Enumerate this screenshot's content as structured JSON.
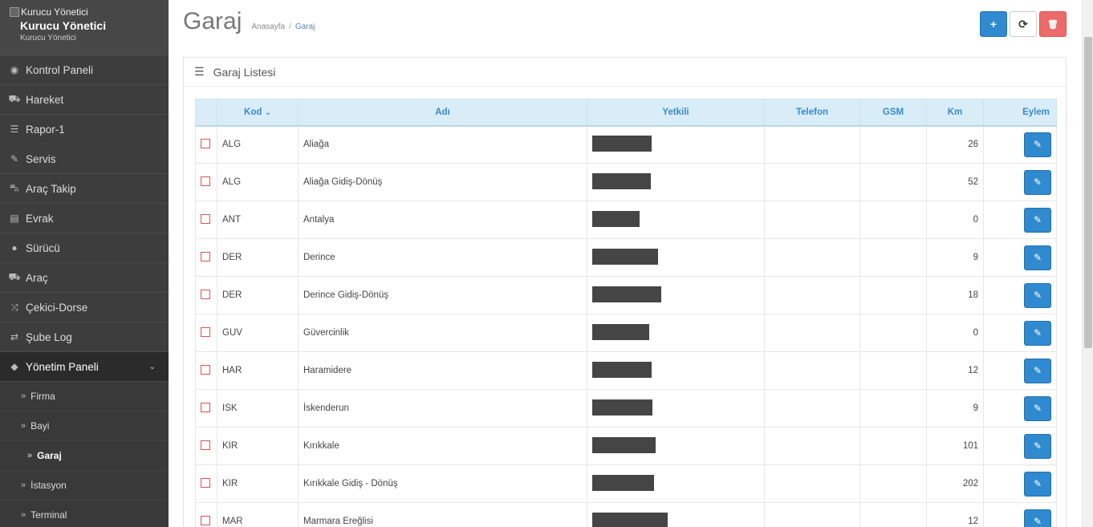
{
  "brand": {
    "logo_alt": "Kurucu Yönetici",
    "name": "Kurucu Yönetici",
    "role": "Kurucu Yönetici"
  },
  "nav": [
    {
      "label": "Kontrol Paneli",
      "icon": "dashboard-icon",
      "glyph": "◉"
    },
    {
      "label": "Hareket",
      "icon": "truck-icon",
      "glyph": "⛟"
    },
    {
      "label": "Rapor-1",
      "icon": "list-icon",
      "glyph": "☰"
    },
    {
      "label": "Servis",
      "icon": "wrench-icon",
      "glyph": "✎"
    },
    {
      "label": "Araç Takip",
      "icon": "car-icon",
      "glyph": "⛍"
    },
    {
      "label": "Evrak",
      "icon": "newspaper-icon",
      "glyph": "▤"
    },
    {
      "label": "Sürücü",
      "icon": "user-icon",
      "glyph": "●"
    },
    {
      "label": "Araç",
      "icon": "truck-icon",
      "glyph": "⛟"
    },
    {
      "label": "Çekici-Dorse",
      "icon": "random-icon",
      "glyph": "⤨"
    },
    {
      "label": "Şube Log",
      "icon": "exchange-icon",
      "glyph": "⇄"
    },
    {
      "label": "Yönetim Paneli",
      "icon": "tags-icon",
      "glyph": "◆"
    }
  ],
  "subnav": [
    {
      "label": "Firma"
    },
    {
      "label": "Bayi"
    },
    {
      "label": "Garaj"
    },
    {
      "label": "İstasyon"
    },
    {
      "label": "Terminal"
    }
  ],
  "page": {
    "title": "Garaj",
    "breadcrumb_home": "Anasayfa",
    "breadcrumb_sep": "/",
    "breadcrumb_current": "Garaj"
  },
  "toolbar": {
    "add": "+",
    "refresh": "⟳",
    "delete": "🗑"
  },
  "portlet": {
    "title": "Garaj Listesi"
  },
  "table": {
    "headers": {
      "kod": "Kod",
      "sort": "⌄",
      "adi": "Adı",
      "yetkili": "Yetkili",
      "telefon": "Telefon",
      "gsm": "GSM",
      "km": "Km",
      "eylem": "Eylem"
    },
    "edit_glyph": "✎",
    "rows": [
      {
        "kod": "ALG",
        "adi": "Aliağa",
        "telefon": "",
        "gsm": "",
        "km": "26"
      },
      {
        "kod": "ALG",
        "adi": "Aliağa Gidiş-Dönüş",
        "telefon": "",
        "gsm": "",
        "km": "52"
      },
      {
        "kod": "ANT",
        "adi": "Antalya",
        "telefon": "",
        "gsm": "",
        "km": "0"
      },
      {
        "kod": "DER",
        "adi": "Derince",
        "telefon": "",
        "gsm": "",
        "km": "9"
      },
      {
        "kod": "DER",
        "adi": "Derince Gidiş-Dönüş",
        "telefon": "",
        "gsm": "",
        "km": "18"
      },
      {
        "kod": "GUV",
        "adi": "Güvercinlik",
        "telefon": "",
        "gsm": "",
        "km": "0"
      },
      {
        "kod": "HAR",
        "adi": "Haramidere",
        "telefon": "",
        "gsm": "",
        "km": "12"
      },
      {
        "kod": "ISK",
        "adi": "İskenderun",
        "telefon": "",
        "gsm": "",
        "km": "9"
      },
      {
        "kod": "KIR",
        "adi": "Kırıkkale",
        "telefon": "",
        "gsm": "",
        "km": "101"
      },
      {
        "kod": "KIR",
        "adi": "Kırıkkale Gidiş - Dönüş",
        "telefon": "",
        "gsm": "",
        "km": "202"
      },
      {
        "kod": "MAR",
        "adi": "Marmara Ereğlisi",
        "telefon": "",
        "gsm": "",
        "km": "12"
      }
    ]
  }
}
